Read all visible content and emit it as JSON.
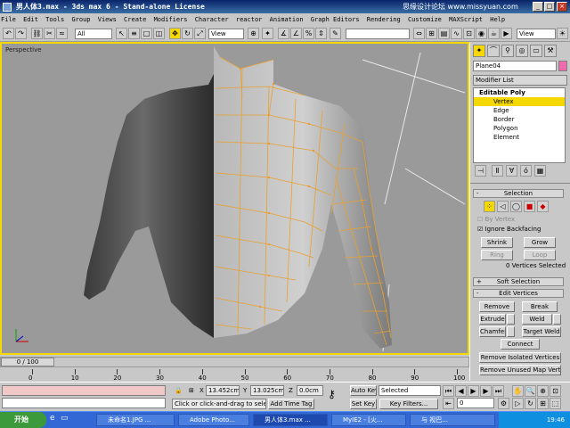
{
  "window": {
    "title": "男人体3.max - 3ds max 6 - Stand-alone License",
    "watermark": "思缘设计论坛 www.missyuan.com",
    "min_label": "_",
    "max_label": "□",
    "close_label": "×"
  },
  "menu": [
    "File",
    "Edit",
    "Tools",
    "Group",
    "Views",
    "Create",
    "Modifiers",
    "Character",
    "reactor",
    "Animation",
    "Graph Editors",
    "Rendering",
    "Customize",
    "MAXScript",
    "Help"
  ],
  "toolbar": {
    "selection_filter": "All",
    "ref_coord": "View",
    "named_sel": "",
    "right_view": "View"
  },
  "viewport": {
    "label": "Perspective"
  },
  "command_panel": {
    "object_name": "Plane04",
    "modifier_list": "Modifier List",
    "stack": {
      "root": "Editable Poly",
      "items": [
        "Vertex",
        "Edge",
        "Border",
        "Polygon",
        "Element"
      ],
      "selected": "Vertex"
    },
    "selection": {
      "title": "Selection",
      "by_vertex": "By Vertex",
      "ignore_backfacing": "Ignore Backfacing",
      "shrink": "Shrink",
      "grow": "Grow",
      "ring": "Ring",
      "loop": "Loop",
      "status": "0 Vertices Selected"
    },
    "soft_selection": "Soft Selection",
    "edit_vertices": {
      "title": "Edit Vertices",
      "remove": "Remove",
      "break": "Break",
      "extrude": "Extrude",
      "weld": "Weld",
      "chamfer": "Chamfer",
      "target_weld": "Target Weld",
      "connect": "Connect",
      "remove_isolated": "Remove Isolated Vertices",
      "remove_unused": "Remove Unused Map Verts"
    },
    "rollout_minus": "-",
    "rollout_plus": "+"
  },
  "timeline": {
    "frame_display": "0 / 100",
    "ticks": [
      0,
      10,
      20,
      30,
      40,
      50,
      60,
      70,
      80,
      90,
      100
    ]
  },
  "status": {
    "x": "13.452cm",
    "y": "13.025cm",
    "z": "0.0cm",
    "prompt": "Click or click-and-drag to select obj",
    "add_time_tag": "Add Time Tag",
    "auto_key": "Auto Key",
    "set_key": "Set Key",
    "key_filters": "Key Filters...",
    "selected_dropdown": "Selected",
    "current_frame": "0",
    "lock_icon": "lock-icon",
    "key_icon": "key-icon"
  },
  "taskbar": {
    "start": "开始",
    "tasks": [
      "未命名1.JPG ...",
      "Adobe Photo...",
      "男人体3.max ...",
      "MyIE2 - [火...",
      "与  视巴..."
    ],
    "active_task": "男人体3.max ...",
    "clock": "19:46"
  },
  "colors": {
    "title_gradient_start": "#0a246a",
    "selection_yellow": "#f5d800",
    "wire_orange": "#e8a030",
    "taskbar_blue": "#3168d5"
  }
}
